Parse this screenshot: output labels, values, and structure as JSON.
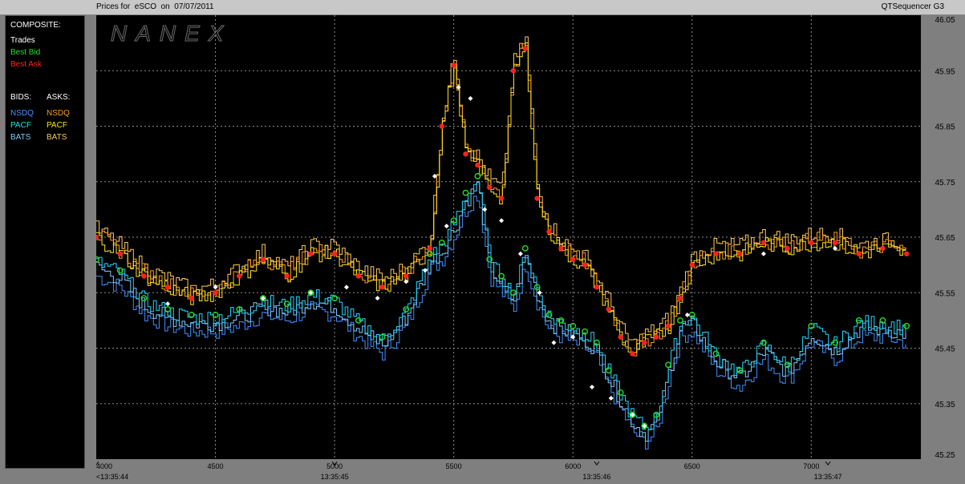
{
  "window": {
    "title_left": "Prices for  eSCO  on  07/07/2011",
    "title_right": "QTSequencer G3"
  },
  "legend": {
    "composite_label": "COMPOSITE:",
    "trades": "Trades",
    "best_bid": "Best Bid",
    "best_ask": "Best Ask",
    "bids_label": "BIDS:",
    "asks_label": "ASKS:",
    "bids": [
      "NSDQ",
      "PACF",
      "BATS"
    ],
    "asks": [
      "NSDQ",
      "PACF",
      "BATS"
    ]
  },
  "watermark": "NANEX",
  "colors": {
    "background": "#000000",
    "grid": "#8a8a8a",
    "trades": "#ffffff",
    "best_bid": "#22dd22",
    "best_ask": "#ff2020",
    "nsdq_bid": "#3f8fff",
    "pacf_bid": "#20d6ff",
    "bats_bid": "#7fc8ff",
    "nsdq_ask": "#ff9a1a",
    "pacf_ask": "#ffe21a",
    "bats_ask": "#ffc860",
    "legend_text": "#ffffff",
    "legend_nsdq_bid": "#4a90ff",
    "legend_pacf_bid": "#22e0e0",
    "legend_bats_bid": "#7fc8ff",
    "legend_nsdq_ask": "#ff9a1a",
    "legend_pacf_ask": "#ffe21a",
    "legend_bats_ask": "#ffc860"
  },
  "chart_data": {
    "type": "line",
    "xlim": [
      4000,
      7460
    ],
    "ylim": [
      45.25,
      46.05
    ],
    "x_ticks": [
      4000,
      4500,
      5000,
      5500,
      6000,
      6500,
      7000
    ],
    "y_ticks": [
      "46.05",
      "45.95",
      "45.85",
      "45.75",
      "45.65",
      "45.55",
      "45.45",
      "45.35",
      "45.25"
    ],
    "time_labels": [
      {
        "x": 4000,
        "label": "<13:35:44"
      },
      {
        "x": 5000,
        "label": "13:35:45"
      },
      {
        "x": 6100,
        "label": "13:35:46"
      },
      {
        "x": 7070,
        "label": "13:35:47"
      }
    ],
    "grid": true,
    "series": [
      {
        "name": "Best Ask",
        "x": [
          4000,
          4100,
          4200,
          4300,
          4400,
          4500,
          4600,
          4700,
          4800,
          4900,
          5000,
          5100,
          5200,
          5300,
          5400,
          5450,
          5500,
          5550,
          5600,
          5650,
          5700,
          5750,
          5800,
          5850,
          5900,
          5950,
          6000,
          6050,
          6100,
          6150,
          6200,
          6250,
          6300,
          6350,
          6400,
          6450,
          6500,
          6600,
          6700,
          6800,
          6900,
          7000,
          7100,
          7200,
          7300,
          7400
        ],
        "y": [
          45.65,
          45.62,
          45.58,
          45.56,
          45.54,
          45.55,
          45.58,
          45.61,
          45.58,
          45.62,
          45.62,
          45.58,
          45.56,
          45.58,
          45.63,
          45.85,
          45.96,
          45.8,
          45.78,
          45.74,
          45.72,
          45.95,
          45.99,
          45.72,
          45.66,
          45.63,
          45.61,
          45.6,
          45.56,
          45.52,
          45.47,
          45.44,
          45.46,
          45.47,
          45.49,
          45.54,
          45.6,
          45.62,
          45.62,
          45.64,
          45.63,
          45.64,
          45.64,
          45.62,
          45.63,
          45.62
        ]
      },
      {
        "name": "Best Bid",
        "x": [
          4000,
          4100,
          4200,
          4300,
          4400,
          4500,
          4600,
          4700,
          4800,
          4900,
          5000,
          5100,
          5200,
          5300,
          5400,
          5450,
          5500,
          5550,
          5600,
          5650,
          5700,
          5750,
          5800,
          5850,
          5900,
          5950,
          6000,
          6050,
          6100,
          6150,
          6200,
          6250,
          6300,
          6350,
          6400,
          6450,
          6500,
          6600,
          6700,
          6800,
          6900,
          7000,
          7100,
          7200,
          7300,
          7400
        ],
        "y": [
          45.61,
          45.59,
          45.54,
          45.52,
          45.51,
          45.51,
          45.52,
          45.54,
          45.53,
          45.55,
          45.54,
          45.5,
          45.47,
          45.52,
          45.62,
          45.64,
          45.68,
          45.73,
          45.76,
          45.61,
          45.58,
          45.55,
          45.63,
          45.56,
          45.51,
          45.5,
          45.49,
          45.48,
          45.46,
          45.41,
          45.37,
          45.33,
          45.31,
          45.33,
          45.42,
          45.5,
          45.51,
          45.44,
          45.41,
          45.46,
          45.42,
          45.49,
          45.46,
          45.5,
          45.5,
          45.49
        ]
      },
      {
        "name": "Trades",
        "x": [
          4300,
          4500,
          4700,
          4900,
          5050,
          5180,
          5300,
          5380,
          5420,
          5470,
          5520,
          5570,
          5630,
          5700,
          5780,
          5860,
          5920,
          6000,
          6080,
          6160,
          6250,
          6300,
          6480,
          6800,
          7100
        ],
        "y": [
          45.53,
          45.56,
          45.54,
          45.55,
          45.56,
          45.54,
          45.57,
          45.59,
          45.76,
          45.67,
          45.92,
          45.9,
          45.7,
          45.68,
          45.62,
          45.55,
          45.46,
          45.47,
          45.38,
          45.36,
          45.33,
          45.31,
          45.51,
          45.62,
          45.63
        ]
      }
    ]
  }
}
